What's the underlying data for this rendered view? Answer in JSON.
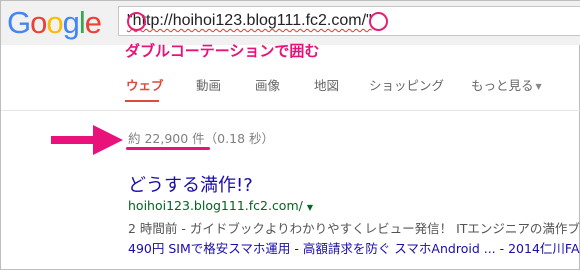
{
  "logo": {
    "letters": [
      "G",
      "o",
      "o",
      "g",
      "l",
      "e"
    ]
  },
  "search": {
    "query": "\"http://hoihoi123.blog111.fc2.com/\""
  },
  "annotation": {
    "top_label": "ダブルコーテーションで囲む",
    "accent_color": "#e8127a"
  },
  "tabs": [
    {
      "label": "ウェブ",
      "active": true
    },
    {
      "label": "動画"
    },
    {
      "label": "画像"
    },
    {
      "label": "地図"
    },
    {
      "label": "ショッピング"
    },
    {
      "label": "もっと見る"
    }
  ],
  "results_count": "約 22,900 件（0.18 秒）",
  "result": {
    "title": "どうする満作!?",
    "url": "hoihoi123.blog111.fc2.com/",
    "snippet": "2 時間前 - ガイドブックよりわかりやすくレビュー発信！ ITエンジニアの満作ブログ",
    "sitelinks": "490円 SIMで格安スマホ運用 - 高額請求を防ぐ スマホAndroid ... - 2014仁川FA"
  },
  "colors": {
    "link": "#1a0dab",
    "url": "#006621",
    "active_tab": "#dd4b39"
  }
}
